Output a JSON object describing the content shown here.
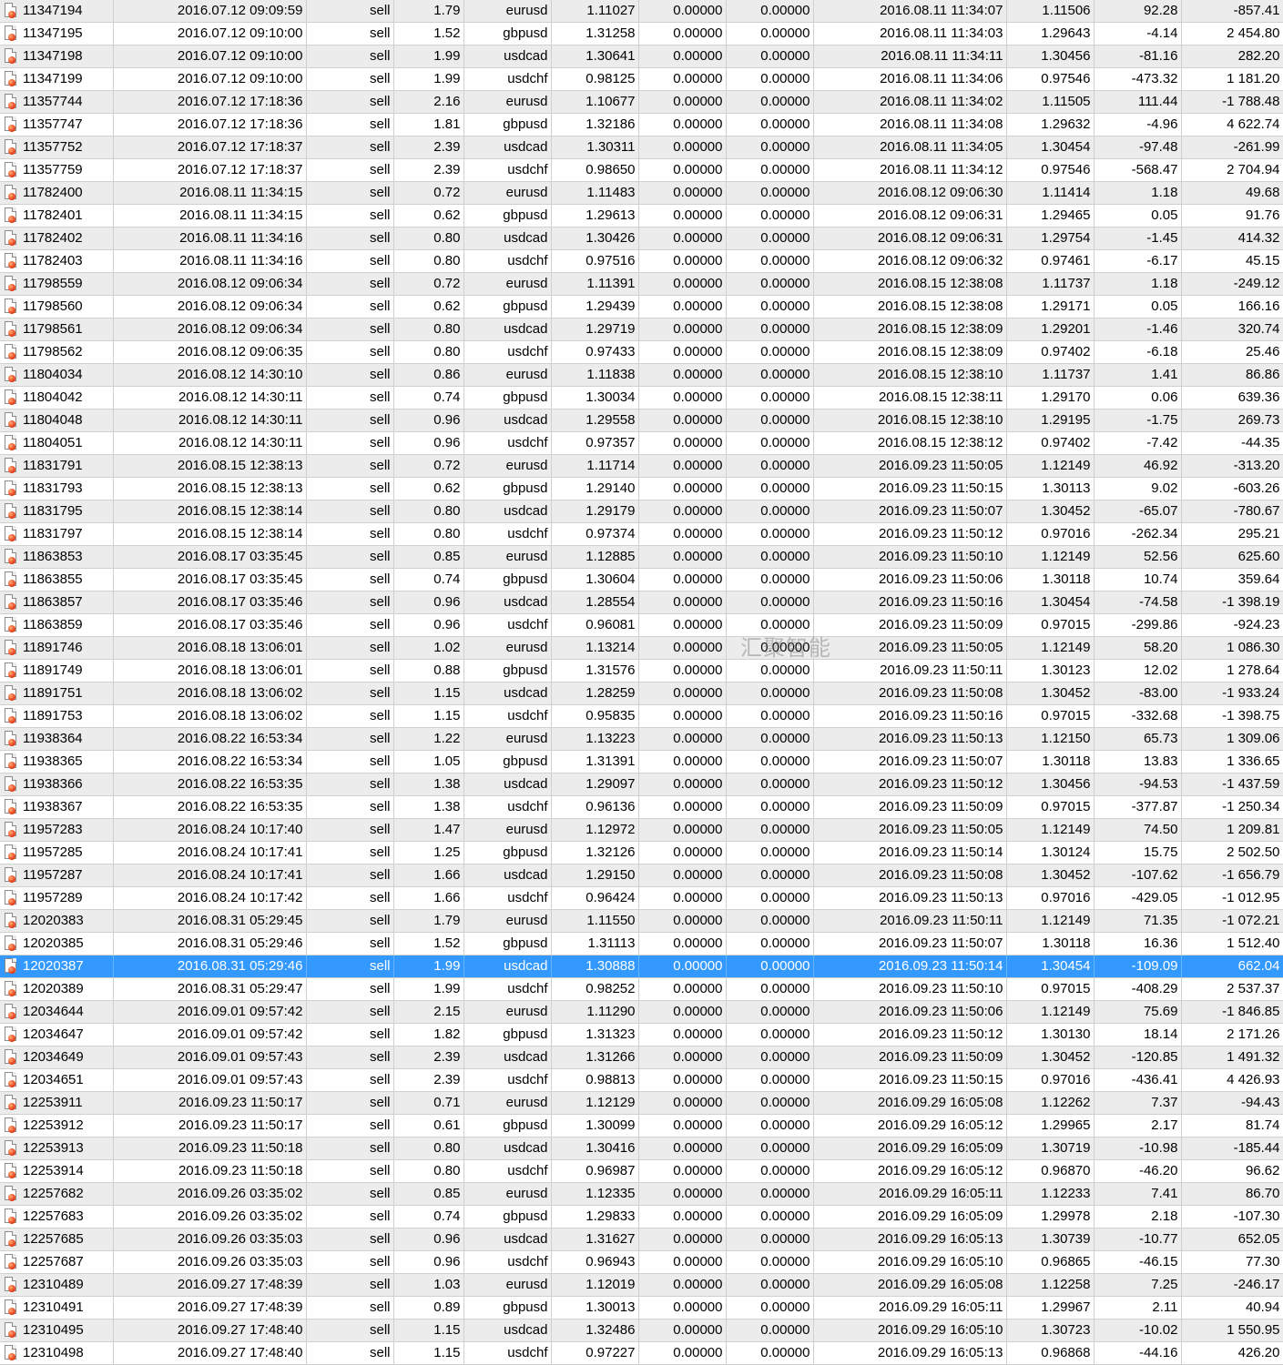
{
  "watermark": "汇聚智能",
  "selected_row": 42,
  "rows": [
    [
      "11347194",
      "2016.07.12 09:09:59",
      "sell",
      "1.79",
      "eurusd",
      "1.11027",
      "0.00000",
      "0.00000",
      "2016.08.11 11:34:07",
      "1.11506",
      "92.28",
      "-857.41"
    ],
    [
      "11347195",
      "2016.07.12 09:10:00",
      "sell",
      "1.52",
      "gbpusd",
      "1.31258",
      "0.00000",
      "0.00000",
      "2016.08.11 11:34:03",
      "1.29643",
      "-4.14",
      "2 454.80"
    ],
    [
      "11347198",
      "2016.07.12 09:10:00",
      "sell",
      "1.99",
      "usdcad",
      "1.30641",
      "0.00000",
      "0.00000",
      "2016.08.11 11:34:11",
      "1.30456",
      "-81.16",
      "282.20"
    ],
    [
      "11347199",
      "2016.07.12 09:10:00",
      "sell",
      "1.99",
      "usdchf",
      "0.98125",
      "0.00000",
      "0.00000",
      "2016.08.11 11:34:06",
      "0.97546",
      "-473.32",
      "1 181.20"
    ],
    [
      "11357744",
      "2016.07.12 17:18:36",
      "sell",
      "2.16",
      "eurusd",
      "1.10677",
      "0.00000",
      "0.00000",
      "2016.08.11 11:34:02",
      "1.11505",
      "111.44",
      "-1 788.48"
    ],
    [
      "11357747",
      "2016.07.12 17:18:36",
      "sell",
      "1.81",
      "gbpusd",
      "1.32186",
      "0.00000",
      "0.00000",
      "2016.08.11 11:34:08",
      "1.29632",
      "-4.96",
      "4 622.74"
    ],
    [
      "11357752",
      "2016.07.12 17:18:37",
      "sell",
      "2.39",
      "usdcad",
      "1.30311",
      "0.00000",
      "0.00000",
      "2016.08.11 11:34:05",
      "1.30454",
      "-97.48",
      "-261.99"
    ],
    [
      "11357759",
      "2016.07.12 17:18:37",
      "sell",
      "2.39",
      "usdchf",
      "0.98650",
      "0.00000",
      "0.00000",
      "2016.08.11 11:34:12",
      "0.97546",
      "-568.47",
      "2 704.94"
    ],
    [
      "11782400",
      "2016.08.11 11:34:15",
      "sell",
      "0.72",
      "eurusd",
      "1.11483",
      "0.00000",
      "0.00000",
      "2016.08.12 09:06:30",
      "1.11414",
      "1.18",
      "49.68"
    ],
    [
      "11782401",
      "2016.08.11 11:34:15",
      "sell",
      "0.62",
      "gbpusd",
      "1.29613",
      "0.00000",
      "0.00000",
      "2016.08.12 09:06:31",
      "1.29465",
      "0.05",
      "91.76"
    ],
    [
      "11782402",
      "2016.08.11 11:34:16",
      "sell",
      "0.80",
      "usdcad",
      "1.30426",
      "0.00000",
      "0.00000",
      "2016.08.12 09:06:31",
      "1.29754",
      "-1.45",
      "414.32"
    ],
    [
      "11782403",
      "2016.08.11 11:34:16",
      "sell",
      "0.80",
      "usdchf",
      "0.97516",
      "0.00000",
      "0.00000",
      "2016.08.12 09:06:32",
      "0.97461",
      "-6.17",
      "45.15"
    ],
    [
      "11798559",
      "2016.08.12 09:06:34",
      "sell",
      "0.72",
      "eurusd",
      "1.11391",
      "0.00000",
      "0.00000",
      "2016.08.15 12:38:08",
      "1.11737",
      "1.18",
      "-249.12"
    ],
    [
      "11798560",
      "2016.08.12 09:06:34",
      "sell",
      "0.62",
      "gbpusd",
      "1.29439",
      "0.00000",
      "0.00000",
      "2016.08.15 12:38:08",
      "1.29171",
      "0.05",
      "166.16"
    ],
    [
      "11798561",
      "2016.08.12 09:06:34",
      "sell",
      "0.80",
      "usdcad",
      "1.29719",
      "0.00000",
      "0.00000",
      "2016.08.15 12:38:09",
      "1.29201",
      "-1.46",
      "320.74"
    ],
    [
      "11798562",
      "2016.08.12 09:06:35",
      "sell",
      "0.80",
      "usdchf",
      "0.97433",
      "0.00000",
      "0.00000",
      "2016.08.15 12:38:09",
      "0.97402",
      "-6.18",
      "25.46"
    ],
    [
      "11804034",
      "2016.08.12 14:30:10",
      "sell",
      "0.86",
      "eurusd",
      "1.11838",
      "0.00000",
      "0.00000",
      "2016.08.15 12:38:10",
      "1.11737",
      "1.41",
      "86.86"
    ],
    [
      "11804042",
      "2016.08.12 14:30:11",
      "sell",
      "0.74",
      "gbpusd",
      "1.30034",
      "0.00000",
      "0.00000",
      "2016.08.15 12:38:11",
      "1.29170",
      "0.06",
      "639.36"
    ],
    [
      "11804048",
      "2016.08.12 14:30:11",
      "sell",
      "0.96",
      "usdcad",
      "1.29558",
      "0.00000",
      "0.00000",
      "2016.08.15 12:38:10",
      "1.29195",
      "-1.75",
      "269.73"
    ],
    [
      "11804051",
      "2016.08.12 14:30:11",
      "sell",
      "0.96",
      "usdchf",
      "0.97357",
      "0.00000",
      "0.00000",
      "2016.08.15 12:38:12",
      "0.97402",
      "-7.42",
      "-44.35"
    ],
    [
      "11831791",
      "2016.08.15 12:38:13",
      "sell",
      "0.72",
      "eurusd",
      "1.11714",
      "0.00000",
      "0.00000",
      "2016.09.23 11:50:05",
      "1.12149",
      "46.92",
      "-313.20"
    ],
    [
      "11831793",
      "2016.08.15 12:38:13",
      "sell",
      "0.62",
      "gbpusd",
      "1.29140",
      "0.00000",
      "0.00000",
      "2016.09.23 11:50:15",
      "1.30113",
      "9.02",
      "-603.26"
    ],
    [
      "11831795",
      "2016.08.15 12:38:14",
      "sell",
      "0.80",
      "usdcad",
      "1.29179",
      "0.00000",
      "0.00000",
      "2016.09.23 11:50:07",
      "1.30452",
      "-65.07",
      "-780.67"
    ],
    [
      "11831797",
      "2016.08.15 12:38:14",
      "sell",
      "0.80",
      "usdchf",
      "0.97374",
      "0.00000",
      "0.00000",
      "2016.09.23 11:50:12",
      "0.97016",
      "-262.34",
      "295.21"
    ],
    [
      "11863853",
      "2016.08.17 03:35:45",
      "sell",
      "0.85",
      "eurusd",
      "1.12885",
      "0.00000",
      "0.00000",
      "2016.09.23 11:50:10",
      "1.12149",
      "52.56",
      "625.60"
    ],
    [
      "11863855",
      "2016.08.17 03:35:45",
      "sell",
      "0.74",
      "gbpusd",
      "1.30604",
      "0.00000",
      "0.00000",
      "2016.09.23 11:50:06",
      "1.30118",
      "10.74",
      "359.64"
    ],
    [
      "11863857",
      "2016.08.17 03:35:46",
      "sell",
      "0.96",
      "usdcad",
      "1.28554",
      "0.00000",
      "0.00000",
      "2016.09.23 11:50:16",
      "1.30454",
      "-74.58",
      "-1 398.19"
    ],
    [
      "11863859",
      "2016.08.17 03:35:46",
      "sell",
      "0.96",
      "usdchf",
      "0.96081",
      "0.00000",
      "0.00000",
      "2016.09.23 11:50:09",
      "0.97015",
      "-299.86",
      "-924.23"
    ],
    [
      "11891746",
      "2016.08.18 13:06:01",
      "sell",
      "1.02",
      "eurusd",
      "1.13214",
      "0.00000",
      "0.00000",
      "2016.09.23 11:50:05",
      "1.12149",
      "58.20",
      "1 086.30"
    ],
    [
      "11891749",
      "2016.08.18 13:06:01",
      "sell",
      "0.88",
      "gbpusd",
      "1.31576",
      "0.00000",
      "0.00000",
      "2016.09.23 11:50:11",
      "1.30123",
      "12.02",
      "1 278.64"
    ],
    [
      "11891751",
      "2016.08.18 13:06:02",
      "sell",
      "1.15",
      "usdcad",
      "1.28259",
      "0.00000",
      "0.00000",
      "2016.09.23 11:50:08",
      "1.30452",
      "-83.00",
      "-1 933.24"
    ],
    [
      "11891753",
      "2016.08.18 13:06:02",
      "sell",
      "1.15",
      "usdchf",
      "0.95835",
      "0.00000",
      "0.00000",
      "2016.09.23 11:50:16",
      "0.97015",
      "-332.68",
      "-1 398.75"
    ],
    [
      "11938364",
      "2016.08.22 16:53:34",
      "sell",
      "1.22",
      "eurusd",
      "1.13223",
      "0.00000",
      "0.00000",
      "2016.09.23 11:50:13",
      "1.12150",
      "65.73",
      "1 309.06"
    ],
    [
      "11938365",
      "2016.08.22 16:53:34",
      "sell",
      "1.05",
      "gbpusd",
      "1.31391",
      "0.00000",
      "0.00000",
      "2016.09.23 11:50:07",
      "1.30118",
      "13.83",
      "1 336.65"
    ],
    [
      "11938366",
      "2016.08.22 16:53:35",
      "sell",
      "1.38",
      "usdcad",
      "1.29097",
      "0.00000",
      "0.00000",
      "2016.09.23 11:50:12",
      "1.30456",
      "-94.53",
      "-1 437.59"
    ],
    [
      "11938367",
      "2016.08.22 16:53:35",
      "sell",
      "1.38",
      "usdchf",
      "0.96136",
      "0.00000",
      "0.00000",
      "2016.09.23 11:50:09",
      "0.97015",
      "-377.87",
      "-1 250.34"
    ],
    [
      "11957283",
      "2016.08.24 10:17:40",
      "sell",
      "1.47",
      "eurusd",
      "1.12972",
      "0.00000",
      "0.00000",
      "2016.09.23 11:50:05",
      "1.12149",
      "74.50",
      "1 209.81"
    ],
    [
      "11957285",
      "2016.08.24 10:17:41",
      "sell",
      "1.25",
      "gbpusd",
      "1.32126",
      "0.00000",
      "0.00000",
      "2016.09.23 11:50:14",
      "1.30124",
      "15.75",
      "2 502.50"
    ],
    [
      "11957287",
      "2016.08.24 10:17:41",
      "sell",
      "1.66",
      "usdcad",
      "1.29150",
      "0.00000",
      "0.00000",
      "2016.09.23 11:50:08",
      "1.30452",
      "-107.62",
      "-1 656.79"
    ],
    [
      "11957289",
      "2016.08.24 10:17:42",
      "sell",
      "1.66",
      "usdchf",
      "0.96424",
      "0.00000",
      "0.00000",
      "2016.09.23 11:50:13",
      "0.97016",
      "-429.05",
      "-1 012.95"
    ],
    [
      "12020383",
      "2016.08.31 05:29:45",
      "sell",
      "1.79",
      "eurusd",
      "1.11550",
      "0.00000",
      "0.00000",
      "2016.09.23 11:50:11",
      "1.12149",
      "71.35",
      "-1 072.21"
    ],
    [
      "12020385",
      "2016.08.31 05:29:46",
      "sell",
      "1.52",
      "gbpusd",
      "1.31113",
      "0.00000",
      "0.00000",
      "2016.09.23 11:50:07",
      "1.30118",
      "16.36",
      "1 512.40"
    ],
    [
      "12020387",
      "2016.08.31 05:29:46",
      "sell",
      "1.99",
      "usdcad",
      "1.30888",
      "0.00000",
      "0.00000",
      "2016.09.23 11:50:14",
      "1.30454",
      "-109.09",
      "662.04"
    ],
    [
      "12020389",
      "2016.08.31 05:29:47",
      "sell",
      "1.99",
      "usdchf",
      "0.98252",
      "0.00000",
      "0.00000",
      "2016.09.23 11:50:10",
      "0.97015",
      "-408.29",
      "2 537.37"
    ],
    [
      "12034644",
      "2016.09.01 09:57:42",
      "sell",
      "2.15",
      "eurusd",
      "1.11290",
      "0.00000",
      "0.00000",
      "2016.09.23 11:50:06",
      "1.12149",
      "75.69",
      "-1 846.85"
    ],
    [
      "12034647",
      "2016.09.01 09:57:42",
      "sell",
      "1.82",
      "gbpusd",
      "1.31323",
      "0.00000",
      "0.00000",
      "2016.09.23 11:50:12",
      "1.30130",
      "18.14",
      "2 171.26"
    ],
    [
      "12034649",
      "2016.09.01 09:57:43",
      "sell",
      "2.39",
      "usdcad",
      "1.31266",
      "0.00000",
      "0.00000",
      "2016.09.23 11:50:09",
      "1.30452",
      "-120.85",
      "1 491.32"
    ],
    [
      "12034651",
      "2016.09.01 09:57:43",
      "sell",
      "2.39",
      "usdchf",
      "0.98813",
      "0.00000",
      "0.00000",
      "2016.09.23 11:50:15",
      "0.97016",
      "-436.41",
      "4 426.93"
    ],
    [
      "12253911",
      "2016.09.23 11:50:17",
      "sell",
      "0.71",
      "eurusd",
      "1.12129",
      "0.00000",
      "0.00000",
      "2016.09.29 16:05:08",
      "1.12262",
      "7.37",
      "-94.43"
    ],
    [
      "12253912",
      "2016.09.23 11:50:17",
      "sell",
      "0.61",
      "gbpusd",
      "1.30099",
      "0.00000",
      "0.00000",
      "2016.09.29 16:05:12",
      "1.29965",
      "2.17",
      "81.74"
    ],
    [
      "12253913",
      "2016.09.23 11:50:18",
      "sell",
      "0.80",
      "usdcad",
      "1.30416",
      "0.00000",
      "0.00000",
      "2016.09.29 16:05:09",
      "1.30719",
      "-10.98",
      "-185.44"
    ],
    [
      "12253914",
      "2016.09.23 11:50:18",
      "sell",
      "0.80",
      "usdchf",
      "0.96987",
      "0.00000",
      "0.00000",
      "2016.09.29 16:05:12",
      "0.96870",
      "-46.20",
      "96.62"
    ],
    [
      "12257682",
      "2016.09.26 03:35:02",
      "sell",
      "0.85",
      "eurusd",
      "1.12335",
      "0.00000",
      "0.00000",
      "2016.09.29 16:05:11",
      "1.12233",
      "7.41",
      "86.70"
    ],
    [
      "12257683",
      "2016.09.26 03:35:02",
      "sell",
      "0.74",
      "gbpusd",
      "1.29833",
      "0.00000",
      "0.00000",
      "2016.09.29 16:05:09",
      "1.29978",
      "2.18",
      "-107.30"
    ],
    [
      "12257685",
      "2016.09.26 03:35:03",
      "sell",
      "0.96",
      "usdcad",
      "1.31627",
      "0.00000",
      "0.00000",
      "2016.09.29 16:05:13",
      "1.30739",
      "-10.77",
      "652.05"
    ],
    [
      "12257687",
      "2016.09.26 03:35:03",
      "sell",
      "0.96",
      "usdchf",
      "0.96943",
      "0.00000",
      "0.00000",
      "2016.09.29 16:05:10",
      "0.96865",
      "-46.15",
      "77.30"
    ],
    [
      "12310489",
      "2016.09.27 17:48:39",
      "sell",
      "1.03",
      "eurusd",
      "1.12019",
      "0.00000",
      "0.00000",
      "2016.09.29 16:05:08",
      "1.12258",
      "7.25",
      "-246.17"
    ],
    [
      "12310491",
      "2016.09.27 17:48:39",
      "sell",
      "0.89",
      "gbpusd",
      "1.30013",
      "0.00000",
      "0.00000",
      "2016.09.29 16:05:11",
      "1.29967",
      "2.11",
      "40.94"
    ],
    [
      "12310495",
      "2016.09.27 17:48:40",
      "sell",
      "1.15",
      "usdcad",
      "1.32486",
      "0.00000",
      "0.00000",
      "2016.09.29 16:05:10",
      "1.30723",
      "-10.02",
      "1 550.95"
    ],
    [
      "12310498",
      "2016.09.27 17:48:40",
      "sell",
      "1.15",
      "usdchf",
      "0.97227",
      "0.00000",
      "0.00000",
      "2016.09.29 16:05:13",
      "0.96868",
      "-44.16",
      "426.20"
    ]
  ]
}
